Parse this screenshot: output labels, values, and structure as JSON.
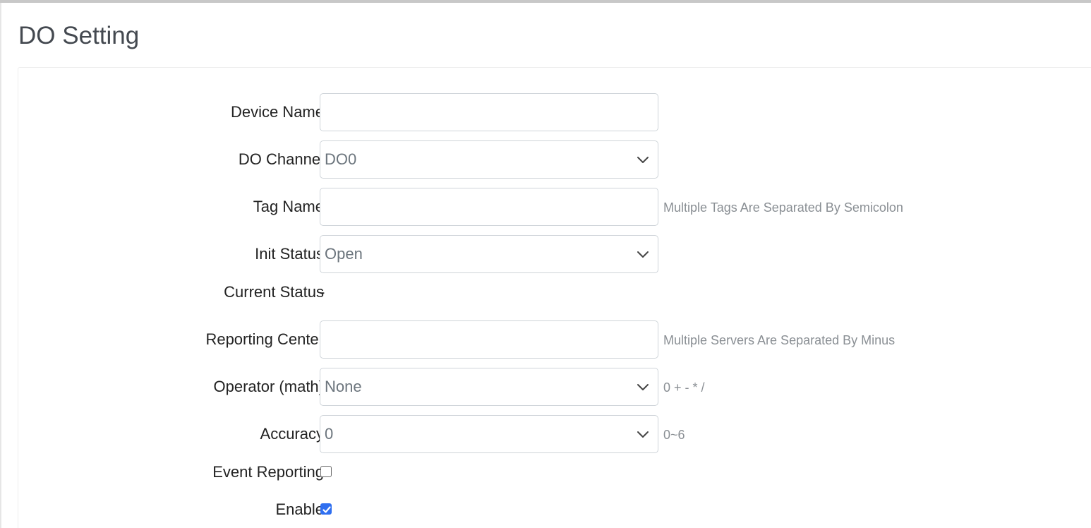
{
  "page": {
    "title": "DO Setting"
  },
  "form": {
    "device_name": {
      "label": "Device Name",
      "value": ""
    },
    "do_channel": {
      "label": "DO Channel",
      "value": "DO0"
    },
    "tag_name": {
      "label": "Tag Name",
      "value": "",
      "help": "Multiple Tags Are Separated By Semicolon"
    },
    "init_status": {
      "label": "Init Status",
      "value": "Open"
    },
    "current_status": {
      "label": "Current Status",
      "value": "-"
    },
    "reporting_center": {
      "label": "Reporting Center",
      "value": "",
      "help": "Multiple Servers Are Separated By Minus"
    },
    "operator": {
      "label": "Operator (math)",
      "value": "None",
      "help": "0 + - * /"
    },
    "accuracy": {
      "label": "Accuracy",
      "value": "0",
      "help": "0~6"
    },
    "event_reporting": {
      "label": "Event Reporting",
      "checked": false
    },
    "enable": {
      "label": "Enable",
      "checked": true
    }
  },
  "colors": {
    "checkbox_checked": "#2f6ff0",
    "help_text": "#8a8f94"
  },
  "icons": {
    "select_chevron": "chevron-down-icon",
    "check_mark": "check-icon"
  }
}
